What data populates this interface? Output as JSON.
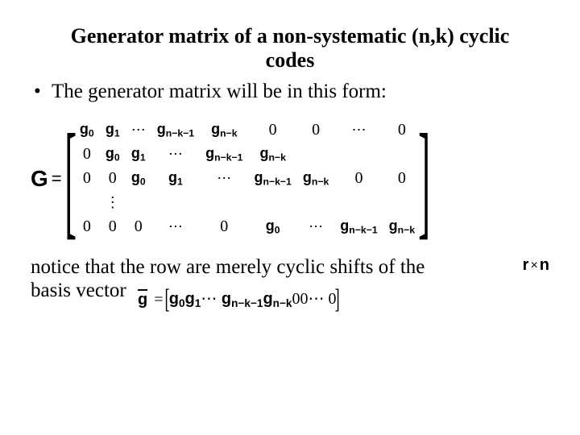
{
  "title_l1": "Generator matrix of a non-systematic (n,k) cyclic",
  "title_l2": "codes",
  "bullet": "The generator matrix will be in this form:",
  "G": "G",
  "eq": "=",
  "cells": {
    "g0": "g",
    "s0": "0",
    "g1": "g",
    "s1": "1",
    "gnk1": "g",
    "snk1": "n−k−1",
    "gnk": "g",
    "snk": "n−k",
    "zero": "0",
    "hdots": "⋯",
    "vdots": "⋮"
  },
  "foot_l1": "notice that the row are merely cyclic shifts of the",
  "foot_l2": "basis vector",
  "rxn_r": "r",
  "rxn_n": "n",
  "basis_g": "g",
  "basis_seq_tail": "00⋯ 0"
}
